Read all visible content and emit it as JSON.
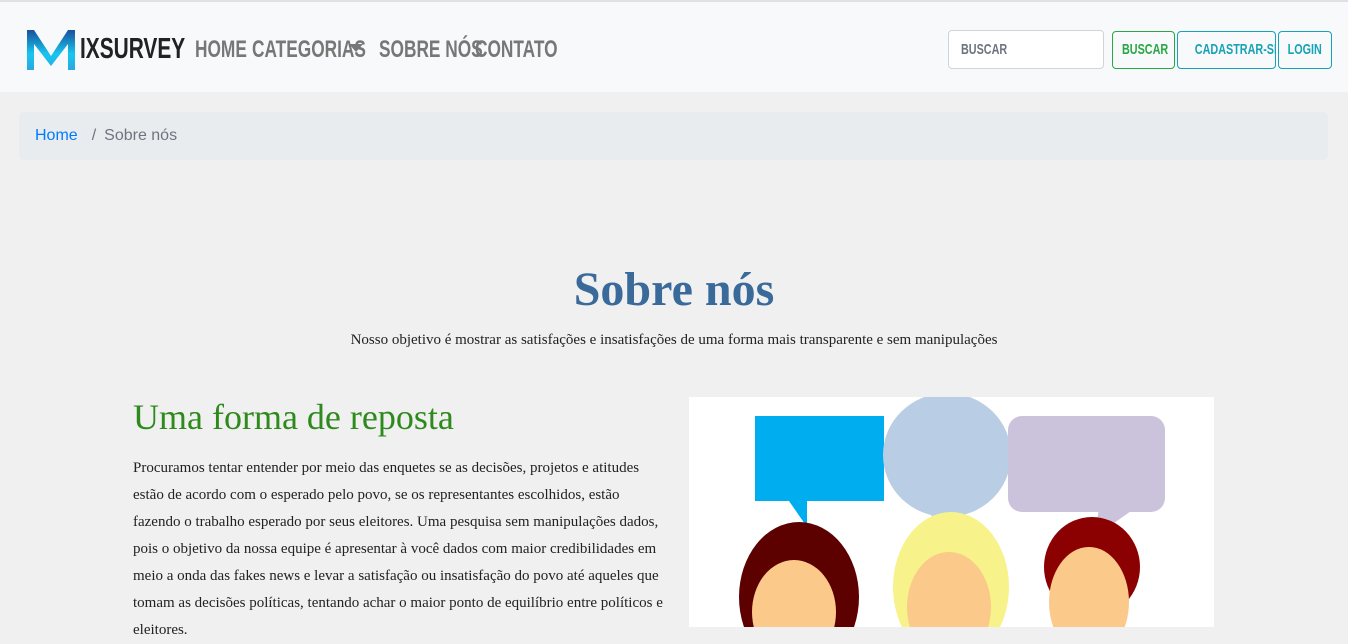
{
  "navbar": {
    "brand": "IXSURVEY",
    "links": [
      "HOME",
      "CATEGORIAS",
      "SOBRE NÓS",
      "CONTATO"
    ],
    "search_placeholder": "BUSCAR",
    "buttons": {
      "search": "BUSCAR",
      "register": "CADASTRAR-SE",
      "login": "LOGIN"
    },
    "colors": {
      "search_button": "#28a745",
      "outline_info": "#17a2b8"
    }
  },
  "breadcrumb": {
    "home": "Home",
    "separator": "/",
    "current": "Sobre nós"
  },
  "main": {
    "title": "Sobre nós",
    "subtitle": "Nosso objetivo é mostrar as satisfações e insatisfações de uma forma mais transparente e sem manipulações",
    "section_title": "Uma forma de reposta",
    "paragraph": "Procuramos tentar entender por meio das enquetes se as decisões, projetos e atitudes estão de acordo com o esperado pelo povo, se os representantes escolhidos, estão fazendo o trabalho esperado por seus eleitores. Uma pesquisa sem manipulações dados, pois o objetivo da nossa equipe é apresentar à você dados com maior credibilidades em meio a onda das fakes news e levar a satisfação ou insatisfação do povo até aqueles que tomam as decisões políticas, tentando achar o maior ponto de equilíbrio entre políticos e eleitores."
  }
}
